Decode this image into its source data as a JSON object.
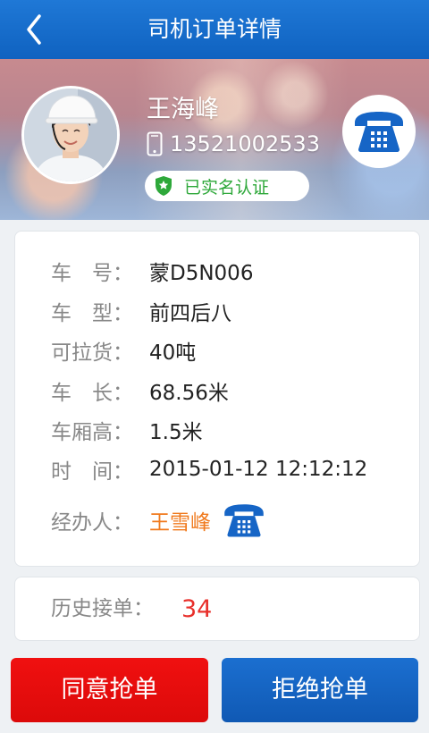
{
  "header": {
    "title": "司机订单详情",
    "back_icon": "chevron-left-icon"
  },
  "driver": {
    "name": "王海峰",
    "phone": "13521002533",
    "verified_label": "已实名认证",
    "call_icon": "telephone-icon"
  },
  "details": [
    {
      "label": "车　号：",
      "value": "蒙D5N006"
    },
    {
      "label": "车　型：",
      "value": "前四后八"
    },
    {
      "label": "可拉货：",
      "value": "40吨"
    },
    {
      "label": "车　长：",
      "value": "68.56米"
    },
    {
      "label": "车厢高：",
      "value": "1.5米"
    },
    {
      "label": "时　间：",
      "value": "2015-01-12 12:12:12"
    }
  ],
  "agent": {
    "label": "经办人：",
    "name": "王雪峰",
    "call_icon": "telephone-icon"
  },
  "history": {
    "label": "历史接单：",
    "count": "34"
  },
  "actions": {
    "agree_label": "同意抢单",
    "reject_label": "拒绝抢单"
  },
  "colors": {
    "primary_blue": "#1665c6",
    "agree_red": "#e80d0d",
    "accent_orange": "#f07a1e",
    "count_red": "#e8302b",
    "verified_green": "#2ea83a"
  }
}
